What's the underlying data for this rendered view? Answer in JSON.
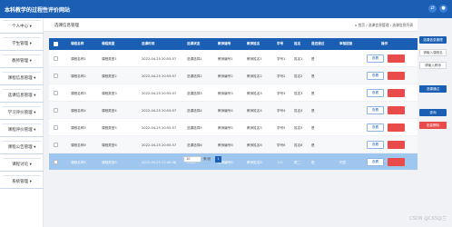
{
  "app": {
    "title": "本科教学的过程性评价网站",
    "icons": [
      "share-icon",
      "user-avatar-icon"
    ]
  },
  "sidebar": {
    "items": [
      {
        "label": "个人中心 ▾"
      },
      {
        "label": "学生管理 ▾"
      },
      {
        "label": "教师管理 ▾"
      },
      {
        "label": "课程信息管理 ▾"
      },
      {
        "label": "选课信息管理 ▾"
      },
      {
        "label": "学习评价管理 ▾"
      },
      {
        "label": "课程评价管理 ▾"
      },
      {
        "label": "课程公告管理 ▾"
      },
      {
        "label": "课程讨论 ▾"
      },
      {
        "label": "系统管理 ▾"
      }
    ]
  },
  "header": {
    "page_title": "选课信息管理",
    "breadcrumb": "⌂ 首页 / 选课信息管理 / 选课信息列表"
  },
  "table": {
    "columns": [
      "课程名称",
      "课程类型",
      "选课时间",
      "选课状态",
      "教师编号",
      "教师姓名",
      "学号",
      "姓名",
      "是否通过",
      "审核回复",
      "操作"
    ],
    "rows": [
      [
        "课程名称1",
        "课程类型1",
        "2022-04-25 20:55:57",
        "选课选择1",
        "教师编号1",
        "教师姓名1",
        "学号1",
        "姓名1",
        "是",
        ""
      ],
      [
        "课程名称2",
        "课程类型2",
        "2022-04-25 20:55:57",
        "选课选择2",
        "教师编号2",
        "教师姓名2",
        "学号2",
        "姓名2",
        "是",
        ""
      ],
      [
        "课程名称3",
        "课程类型3",
        "2022-04-25 20:55:57",
        "选课选择3",
        "教师编号3",
        "教师姓名3",
        "学号3",
        "姓名3",
        "是",
        ""
      ],
      [
        "课程名称4",
        "课程类型4",
        "2022-04-25 20:55:57",
        "选课选择4",
        "教师编号4",
        "教师姓名4",
        "学号4",
        "姓名4",
        "是",
        ""
      ],
      [
        "课程名称5",
        "课程类型5",
        "2022-04-25 20:55:57",
        "选课选择5",
        "教师编号5",
        "教师姓名5",
        "学号5",
        "姓名5",
        "是",
        ""
      ],
      [
        "课程名称6",
        "课程类型6",
        "2022-04-25 20:55:57",
        "选课选择6",
        "教师编号6",
        "教师姓名6",
        "学号6",
        "姓名6",
        "是",
        ""
      ],
      [
        "课程名称8",
        "课程类型8",
        "2022-04-25 22:40:08",
        "XXXX",
        "教师编号8",
        "教师姓名8",
        "111",
        "覆二",
        "是",
        "同意"
      ]
    ],
    "view_label": "查看",
    "selected_row": 6
  },
  "pagination": {
    "page_size": "10",
    "goto_label": "条/页",
    "current_page": "1"
  },
  "right_panel": {
    "buttons": [
      {
        "label": "选课信息管理",
        "style": "blue"
      },
      {
        "label": "请输入课程名",
        "style": "plain"
      },
      {
        "label": "请输入教师",
        "style": "plain"
      },
      {
        "label": "选课通过",
        "style": "blue"
      },
      {
        "label": "查询",
        "style": "blue"
      },
      {
        "label": "批量删除",
        "style": "red"
      }
    ]
  },
  "watermark": "CSDN @CKS@兰"
}
